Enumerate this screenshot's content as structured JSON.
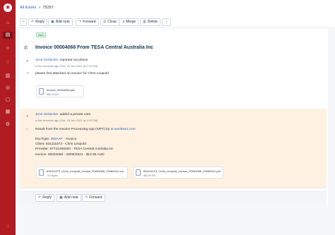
{
  "sidebar": {
    "items": [
      {
        "icon": "home-icon",
        "glyph": "⌂"
      },
      {
        "icon": "tickets-icon",
        "glyph": "▤"
      },
      {
        "icon": "contacts-icon",
        "glyph": "☺"
      },
      {
        "icon": "alerts-icon",
        "glyph": "♢"
      },
      {
        "icon": "book-icon",
        "glyph": "▥"
      },
      {
        "icon": "globe-icon",
        "glyph": "◎"
      },
      {
        "icon": "chat-icon",
        "glyph": "▢"
      },
      {
        "icon": "reports-icon",
        "glyph": "▦"
      },
      {
        "icon": "settings-icon",
        "glyph": "⚙"
      },
      {
        "icon": "apps-icon",
        "glyph": "⁙"
      }
    ]
  },
  "breadcrumb": {
    "all_tickets": "All tickets",
    "separator": ">",
    "ticket_id": "75257"
  },
  "toolbar": {
    "reply": "Reply",
    "add_note": "Add note",
    "forward": "Forward",
    "close": "Close",
    "merge": "Merge",
    "delete": "Delete",
    "more": "⋮"
  },
  "ticket": {
    "status_tag": "New",
    "subject": "Invoice 00004066 From TESA Central Australia Inc"
  },
  "message1": {
    "author": "Jens Gerlacher",
    "action": "reported via phone",
    "time": "a few seconds ago (Tue, 29 Jun 2021 at 2:20 PM)",
    "body": "please find attached an invoice for Chris Leopold",
    "attachments": [
      {
        "name": "Invoice_00004066.pdf",
        "size": "880.94 KB"
      }
    ]
  },
  "message2": {
    "author": "Jens Gerlacher",
    "action": "added a private note",
    "time": "a few seconds ago (Tue, 29 Jun 2021 at 2:20 PM)",
    "body_prefix": "Result from the Invoice Processing App (IVPT) by",
    "body_link": "ai-worlds4u.com",
    "doctype_label": "DocType:",
    "doctype_link": "482AAF",
    "doctype_suffix": "- Invoice",
    "details": [
      "Client: 831111073 - Chris Leopold",
      "Provider: 67741268260 - TESA Central Australia Inc",
      "Invoice: 00004066 - 29/06/2021 - $12.95 AUD"
    ],
    "attachments": [
      {
        "name": "831111073_Chris_Leopold_Invoice_00004066_29062021.csv",
        "size": "710 Bytes"
      },
      {
        "name": "831111073_Chris_Leopold_Invoice_00004066_29062021.pdf",
        "size": "880.94 KB"
      }
    ]
  },
  "reply_bar": {
    "reply": "Reply",
    "add_note": "Add note",
    "forward": "Forward"
  },
  "colors": {
    "sidebar": "#b01c22",
    "link": "#2c5cc5",
    "private_note_bg": "#fef1e1"
  }
}
